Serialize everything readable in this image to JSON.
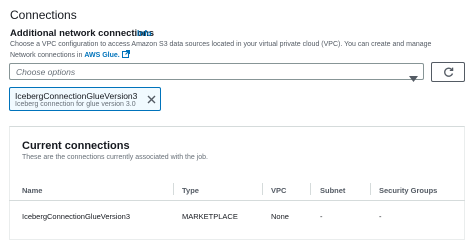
{
  "section": {
    "title": "Connections"
  },
  "field": {
    "label": "Additional network connections",
    "info_link": "Info",
    "description_line1": "Choose a VPC configuration to access Amazon S3 data sources located in your virtual private cloud (VPC). You can create and manage",
    "description_line2": "Network connections in ",
    "glue_link": "AWS Glue."
  },
  "select": {
    "placeholder": "Choose options",
    "icon": "caret-down-icon"
  },
  "refresh_button": {
    "icon": "refresh-icon"
  },
  "selected_token": {
    "name": "IcebergConnectionGlueVersion3",
    "description": "Iceberg connection for glue version 3.0",
    "icon": "close-icon"
  },
  "panel": {
    "title": "Current connections",
    "subtitle": "These are the connections currently associated with the job.",
    "columns": [
      "Name",
      "Type",
      "VPC",
      "Subnet",
      "Security Groups"
    ],
    "rows": [
      [
        "IcebergConnectionGlueVersion3",
        "MARKETPLACE",
        "None",
        "-",
        "-"
      ]
    ]
  },
  "colors": {
    "link": "#0073bb",
    "text": "#16191f",
    "muted": "#687078",
    "border": "#879596"
  }
}
